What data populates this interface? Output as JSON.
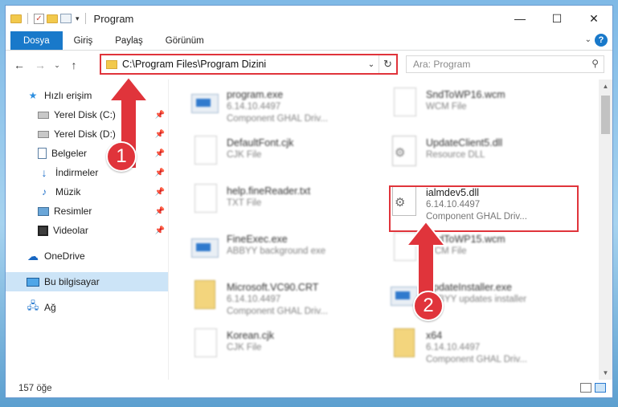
{
  "window": {
    "title": "Program",
    "controls": {
      "minimize": "—",
      "maximize": "☐",
      "close": "✕"
    }
  },
  "ribbon": {
    "tabs": [
      "Dosya",
      "Giriş",
      "Paylaş",
      "Görünüm"
    ],
    "help": "?"
  },
  "address": {
    "path": "C:\\Program Files\\Program Dizini",
    "search_placeholder": "Ara: Program"
  },
  "sidebar": {
    "items": [
      {
        "label": "Hızlı erişim",
        "icon": "star-icon",
        "pinned": false
      },
      {
        "label": "Yerel Disk (C:)",
        "icon": "disk-icon",
        "pinned": true
      },
      {
        "label": "Yerel Disk (D:)",
        "icon": "disk-icon",
        "pinned": true
      },
      {
        "label": "Belgeler",
        "icon": "document-icon",
        "pinned": true
      },
      {
        "label": "İndirmeler",
        "icon": "download-icon",
        "pinned": true
      },
      {
        "label": "Müzik",
        "icon": "music-icon",
        "pinned": true
      },
      {
        "label": "Resimler",
        "icon": "pictures-icon",
        "pinned": true
      },
      {
        "label": "Videolar",
        "icon": "videos-icon",
        "pinned": true
      },
      {
        "label": "OneDrive",
        "icon": "cloud-icon",
        "pinned": false
      },
      {
        "label": "Bu bilgisayar",
        "icon": "computer-icon",
        "pinned": false
      },
      {
        "label": "Ağ",
        "icon": "network-icon",
        "pinned": false
      }
    ]
  },
  "files": {
    "left": [
      {
        "name": "program.exe",
        "line2": "6.14.10.4497",
        "line3": "Component GHAL Driv...",
        "icon": "exe-icon"
      },
      {
        "name": "DefaultFont.cjk",
        "line2": "CJK File",
        "line3": "",
        "icon": "document-icon"
      },
      {
        "name": "help.fineReader.txt",
        "line2": "TXT File",
        "line3": "",
        "icon": "document-icon"
      },
      {
        "name": "FineExec.exe",
        "line2": "ABBYY background exe",
        "line3": "",
        "icon": "exe-icon"
      },
      {
        "name": "Microsoft.VC90.CRT",
        "line2": "6.14.10.4497",
        "line3": "Component GHAL Driv...",
        "icon": "folder-icon"
      },
      {
        "name": "Korean.cjk",
        "line2": "CJK File",
        "line3": "",
        "icon": "document-icon"
      }
    ],
    "right": [
      {
        "name": "SndToWP16.wcm",
        "line2": "WCM File",
        "line3": "",
        "icon": "document-icon"
      },
      {
        "name": "UpdateClient5.dll",
        "line2": "Resource DLL",
        "line3": "",
        "icon": "dll-icon"
      },
      {
        "name": "ialmdev5.dll",
        "line2": "6.14.10.4497",
        "line3": "Component GHAL Driv...",
        "icon": "dll-icon"
      },
      {
        "name": "SndToWP15.wcm",
        "line2": "WCM File",
        "line3": "",
        "icon": "document-icon"
      },
      {
        "name": "UpdateInstaller.exe",
        "line2": "ABBYY updates installer",
        "line3": "",
        "icon": "exe-icon"
      },
      {
        "name": "x64",
        "line2": "6.14.10.4497",
        "line3": "Component GHAL Driv...",
        "icon": "folder-icon"
      }
    ]
  },
  "status": {
    "count": "157 öğe"
  },
  "annotations": {
    "badge1": "1",
    "badge2": "2",
    "accent": "#e0343b"
  }
}
